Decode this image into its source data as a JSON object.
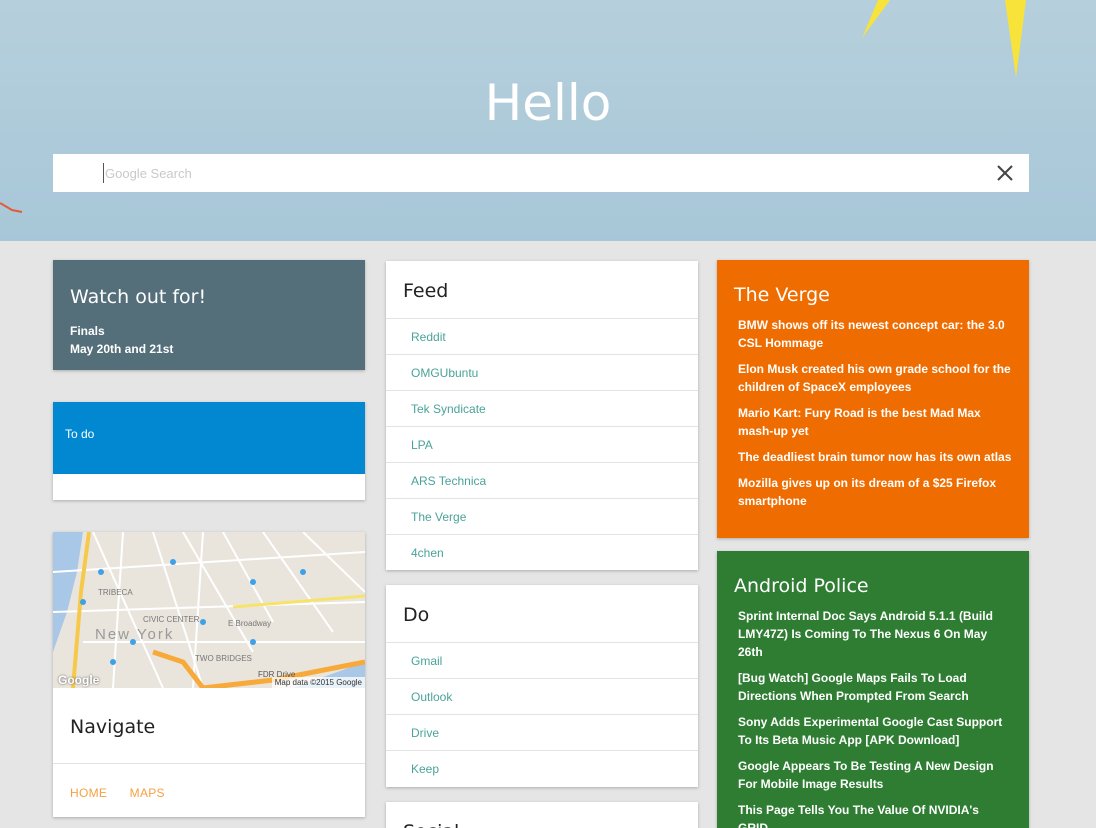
{
  "header": {
    "title": "Hello",
    "search_placeholder": "Google Search",
    "search_value": "",
    "clear_icon": "close-icon",
    "bg_color": "#a9c9d9"
  },
  "watch": {
    "title": "Watch out for!",
    "item_name": "Finals",
    "item_date": "May 20th and 21st",
    "bg_color": "#546e7a"
  },
  "todo": {
    "label": "To do",
    "bg_color": "#0288d1"
  },
  "navigate": {
    "map_labels": {
      "google": "Google",
      "attribution": "Map data ©2015 Google",
      "new_york": "New York",
      "tribeca": "TRIBECA",
      "civic": "CIVIC CENTER",
      "two_bridges": "TWO BRIDGES",
      "broadway": "E Broadway",
      "fdr": "FDR Drive"
    },
    "title": "Navigate",
    "actions": [
      "HOME",
      "MAPS"
    ],
    "action_color": "#f5a142"
  },
  "feed": {
    "title": "Feed",
    "items": [
      "Reddit",
      "OMGUbuntu",
      "Tek Syndicate",
      "LPA",
      "ARS Technica",
      "The Verge",
      "4chen"
    ]
  },
  "do": {
    "title": "Do",
    "items": [
      "Gmail",
      "Outlook",
      "Drive",
      "Keep"
    ]
  },
  "social": {
    "title": "Social"
  },
  "verge": {
    "title": "The Verge",
    "bg_color": "#ef6c00",
    "items": [
      "BMW shows off its newest concept car: the 3.0 CSL Hommage",
      "Elon Musk created his own grade school for the children of SpaceX employees",
      "Mario Kart: Fury Road is the best Mad Max mash-up yet",
      "The deadliest brain tumor now has its own atlas",
      "Mozilla gives up on its dream of a $25 Firefox smartphone"
    ]
  },
  "police": {
    "title": "Android Police",
    "bg_color": "#2e7d32",
    "items": [
      "Sprint Internal Doc Says Android 5.1.1 (Build LMY47Z) Is Coming To The Nexus 6 On May 26th",
      "[Bug Watch] Google Maps Fails To Load Directions When Prompted From Search",
      "Sony Adds Experimental Google Cast Support To Its Beta Music App [APK Download]",
      "Google Appears To Be Testing A New Design For Mobile Image Results",
      "This Page Tells You The Value Of NVIDIA's GRID"
    ]
  }
}
